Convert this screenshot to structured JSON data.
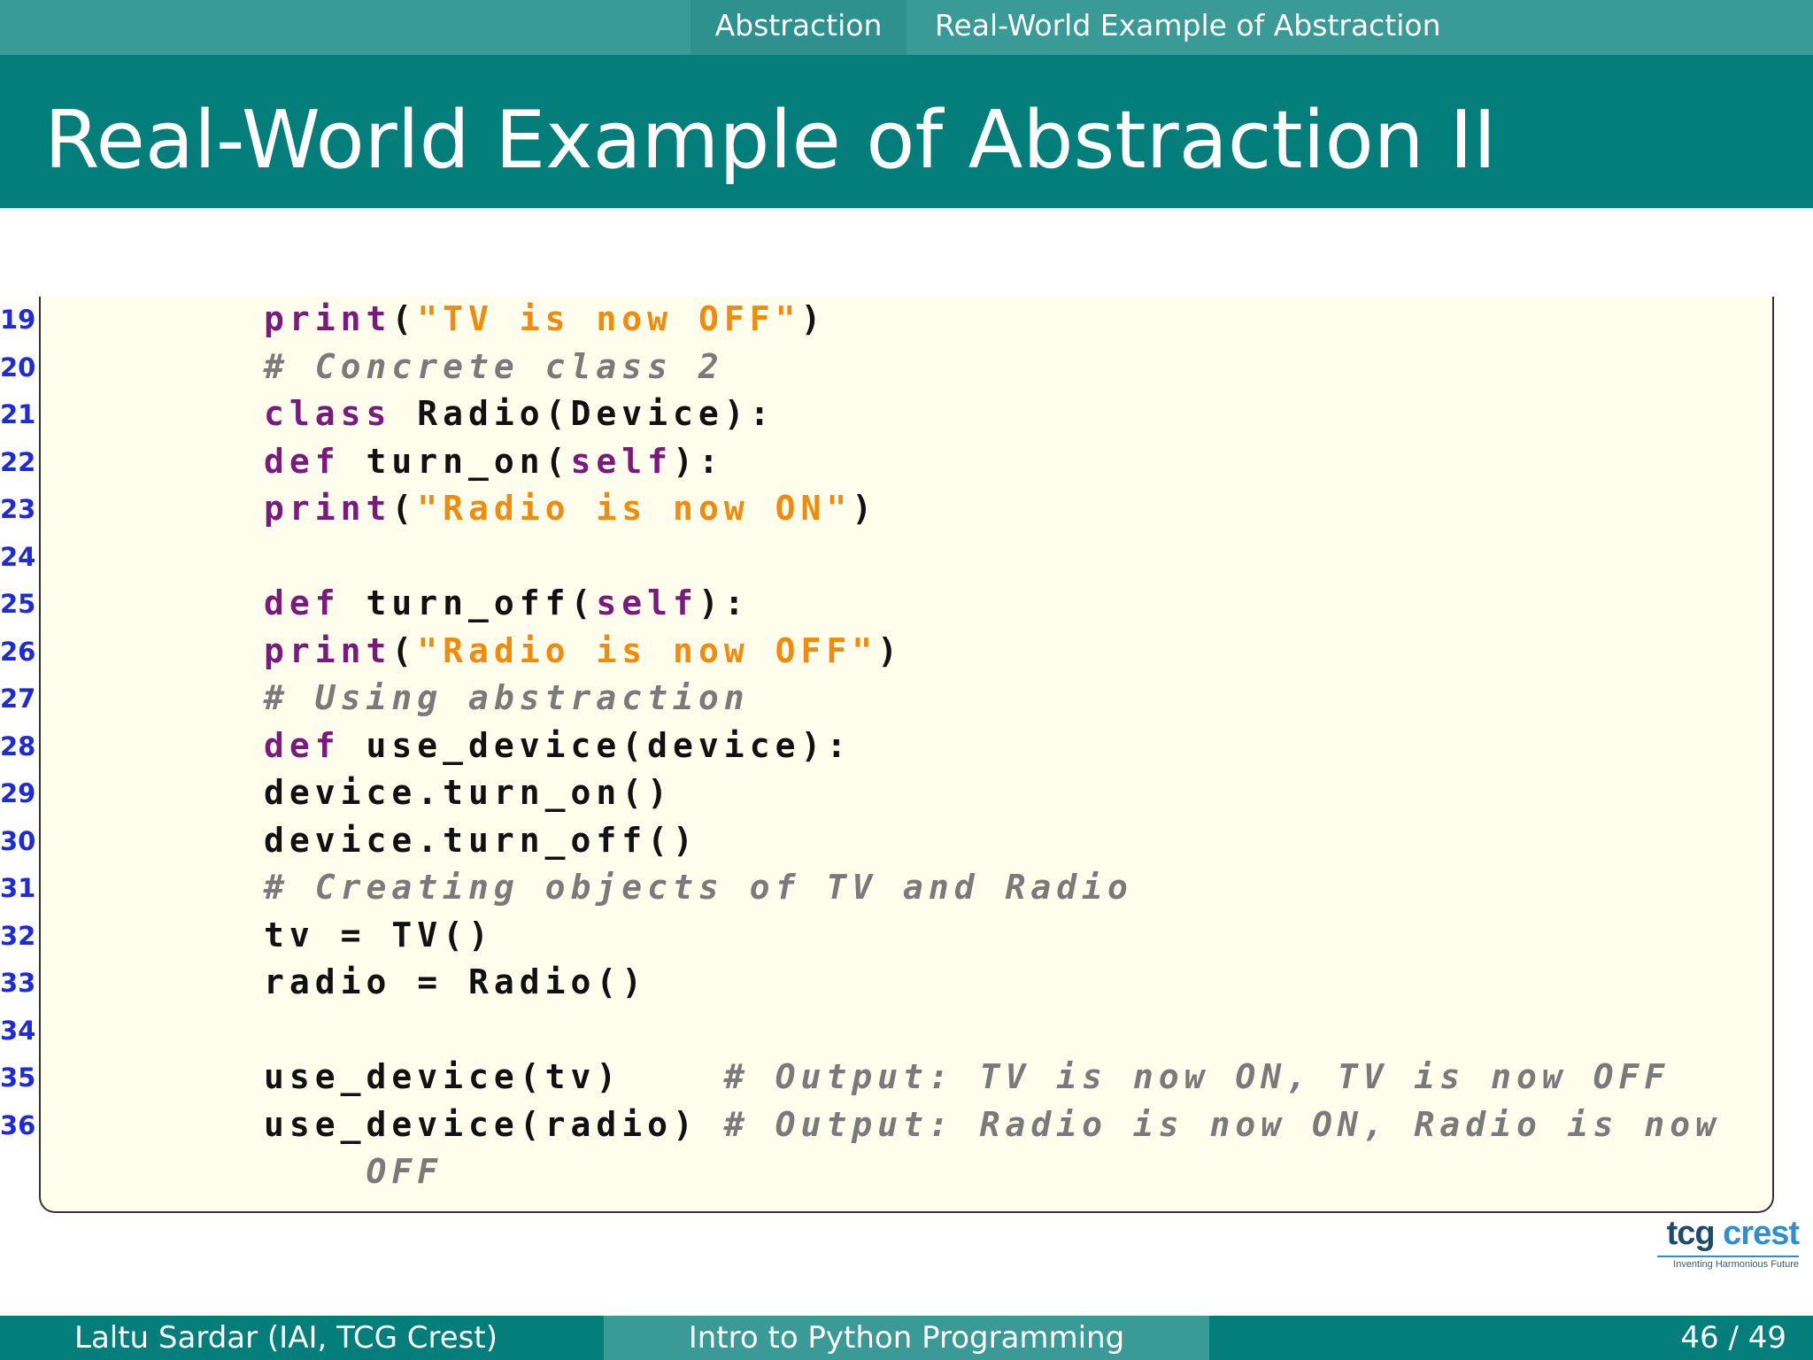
{
  "nav": {
    "section": "Abstraction",
    "subsection": "Real-World Example of Abstraction"
  },
  "title": "Real-World Example of Abstraction II",
  "code_lines": [
    {
      "num": "19",
      "tokens": [
        {
          "t": "print",
          "c": "kw"
        },
        {
          "t": "(",
          "c": ""
        },
        {
          "t": "\"TV is now OFF\"",
          "c": "str"
        },
        {
          "t": ")",
          "c": ""
        }
      ]
    },
    {
      "num": "20",
      "tokens": [
        {
          "t": "# Concrete class 2",
          "c": "com"
        }
      ]
    },
    {
      "num": "21",
      "tokens": [
        {
          "t": "class",
          "c": "kw"
        },
        {
          "t": " Radio(Device):",
          "c": ""
        }
      ]
    },
    {
      "num": "22",
      "tokens": [
        {
          "t": "def",
          "c": "kw"
        },
        {
          "t": " turn_on(",
          "c": ""
        },
        {
          "t": "self",
          "c": "kw"
        },
        {
          "t": "):",
          "c": ""
        }
      ]
    },
    {
      "num": "23",
      "tokens": [
        {
          "t": "print",
          "c": "kw"
        },
        {
          "t": "(",
          "c": ""
        },
        {
          "t": "\"Radio is now ON\"",
          "c": "str"
        },
        {
          "t": ")",
          "c": ""
        }
      ]
    },
    {
      "num": "24",
      "tokens": []
    },
    {
      "num": "25",
      "tokens": [
        {
          "t": "def",
          "c": "kw"
        },
        {
          "t": " turn_off(",
          "c": ""
        },
        {
          "t": "self",
          "c": "kw"
        },
        {
          "t": "):",
          "c": ""
        }
      ]
    },
    {
      "num": "26",
      "tokens": [
        {
          "t": "print",
          "c": "kw"
        },
        {
          "t": "(",
          "c": ""
        },
        {
          "t": "\"Radio is now OFF\"",
          "c": "str"
        },
        {
          "t": ")",
          "c": ""
        }
      ]
    },
    {
      "num": "27",
      "tokens": [
        {
          "t": "# Using abstraction",
          "c": "com"
        }
      ]
    },
    {
      "num": "28",
      "tokens": [
        {
          "t": "def",
          "c": "kw"
        },
        {
          "t": " use_device(device):",
          "c": ""
        }
      ]
    },
    {
      "num": "29",
      "tokens": [
        {
          "t": "device.turn_on()",
          "c": ""
        }
      ]
    },
    {
      "num": "30",
      "tokens": [
        {
          "t": "device.turn_off()",
          "c": ""
        }
      ]
    },
    {
      "num": "31",
      "tokens": [
        {
          "t": "# Creating objects of TV and Radio",
          "c": "com"
        }
      ]
    },
    {
      "num": "32",
      "tokens": [
        {
          "t": "tv = TV()",
          "c": ""
        }
      ]
    },
    {
      "num": "33",
      "tokens": [
        {
          "t": "radio = Radio()",
          "c": ""
        }
      ]
    },
    {
      "num": "34",
      "tokens": []
    },
    {
      "num": "35",
      "tokens": [
        {
          "t": "use_device(tv)    ",
          "c": ""
        },
        {
          "t": "# Output: TV is now ON, TV is now OFF",
          "c": "com"
        }
      ]
    },
    {
      "num": "36",
      "tokens": [
        {
          "t": "use_device(radio) ",
          "c": ""
        },
        {
          "t": "# Output: Radio is now ON, Radio is now",
          "c": "com"
        }
      ]
    },
    {
      "num": "",
      "tokens": [
        {
          "t": "    OFF",
          "c": "com"
        }
      ]
    }
  ],
  "logo": {
    "word_a": "tcg",
    "word_b": "crest",
    "tagline": "Inventing Harmonious Future"
  },
  "footer": {
    "author": "Laltu Sardar  (IAI, TCG Crest)",
    "course": "Intro to Python Programming",
    "page": "46 / 49"
  },
  "colors": {
    "header_dark": "#047e7b",
    "header_light": "#3a9a96",
    "keyword": "#7a1a7f",
    "string": "#f28b0b",
    "comment": "#7a7a7a",
    "line_number": "#1f2bd8",
    "code_background": "#fffdec"
  }
}
